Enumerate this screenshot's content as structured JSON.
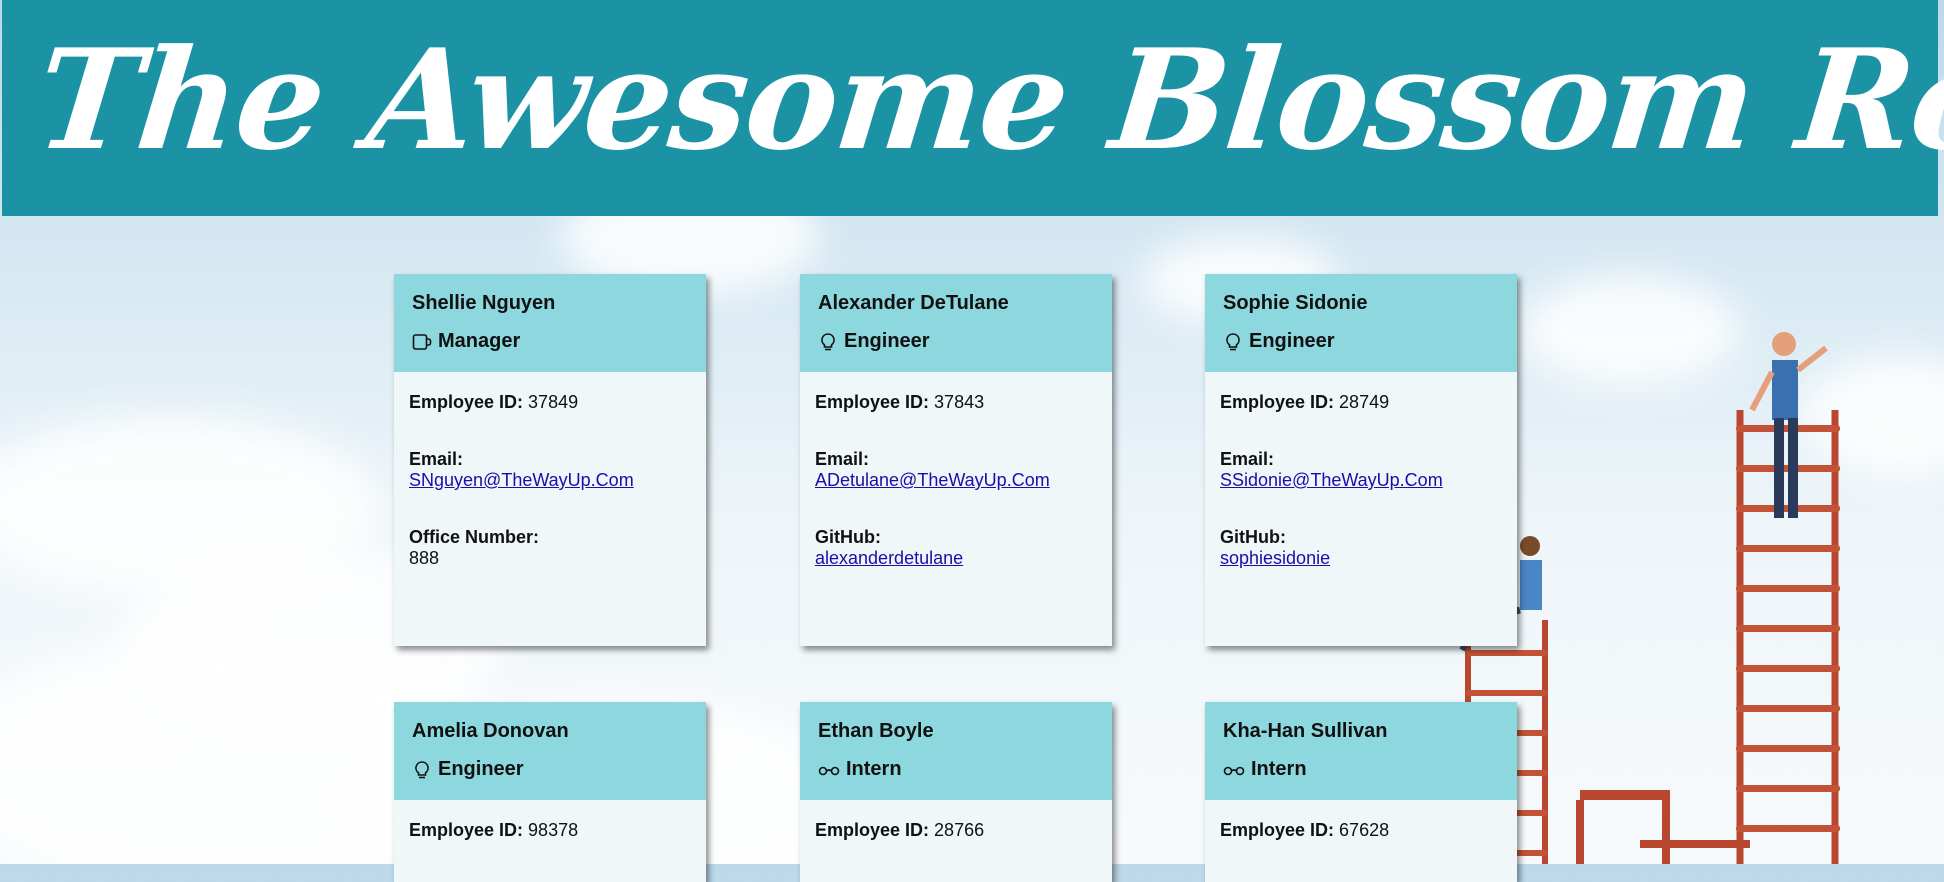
{
  "header": {
    "title": "The Awesome Blossom Roster"
  },
  "labels": {
    "employee_id": "Employee ID:",
    "email": "Email:",
    "office_number": "Office Number:",
    "github": "GitHub:"
  },
  "cards": [
    {
      "name": "Shellie Nguyen",
      "role": "Manager",
      "role_icon": "mug-icon",
      "id": "37849",
      "email": "SNguyen@TheWayUp.Com",
      "office_number": "888"
    },
    {
      "name": "Alexander DeTulane",
      "role": "Engineer",
      "role_icon": "lightbulb-icon",
      "id": "37843",
      "email": "ADetulane@TheWayUp.Com",
      "github": "alexanderdetulane"
    },
    {
      "name": "Sophie Sidonie",
      "role": "Engineer",
      "role_icon": "lightbulb-icon",
      "id": "28749",
      "email": "SSidonie@TheWayUp.Com",
      "github": "sophiesidonie"
    },
    {
      "name": "Amelia Donovan",
      "role": "Engineer",
      "role_icon": "lightbulb-icon",
      "id": "98378"
    },
    {
      "name": "Ethan Boyle",
      "role": "Intern",
      "role_icon": "glasses-icon",
      "id": "28766"
    },
    {
      "name": "Kha-Han Sullivan",
      "role": "Intern",
      "role_icon": "glasses-icon",
      "id": "67628"
    }
  ],
  "colors": {
    "banner": "#1c93a5",
    "card_header": "#8dd8df",
    "card_body": "#f0f7f8",
    "link": "#1a0dab"
  }
}
